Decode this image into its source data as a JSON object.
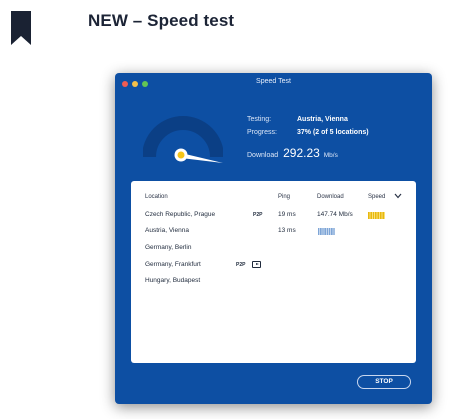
{
  "page": {
    "heading": "NEW – Speed test"
  },
  "window": {
    "title": "Speed Test"
  },
  "status": {
    "testing_label": "Testing:",
    "testing_value": "Austria, Vienna",
    "progress_label": "Progress:",
    "progress_value": "37% (2 of 5 locations)",
    "download_label": "Download",
    "download_value": "292.23",
    "download_unit": "Mb/s"
  },
  "gauge": {
    "value_mbps": 292.23
  },
  "table": {
    "headers": {
      "location": "Location",
      "ping": "Ping",
      "download": "Download",
      "speed": "Speed"
    },
    "rows": [
      {
        "location": "Czech Republic, Prague",
        "badge": "P2P",
        "ping": "19 ms",
        "download": "147.74 Mb/s"
      },
      {
        "location": "Austria, Vienna",
        "ping": "13 ms"
      },
      {
        "location": "Germany, Berlin"
      },
      {
        "location": "Germany, Frankfurt",
        "badge": "P2P"
      },
      {
        "location": "Hungary, Budapest"
      }
    ]
  },
  "buttons": {
    "stop": "STOP"
  },
  "colors": {
    "window_bg": "#0d4fa3",
    "accent_yellow": "#f5c518",
    "gauge_dark": "#0b3f85",
    "heading": "#1c2436"
  },
  "icons": [
    "bookmark-icon",
    "gauge-icon",
    "chevron-down-icon",
    "streaming-icon"
  ]
}
